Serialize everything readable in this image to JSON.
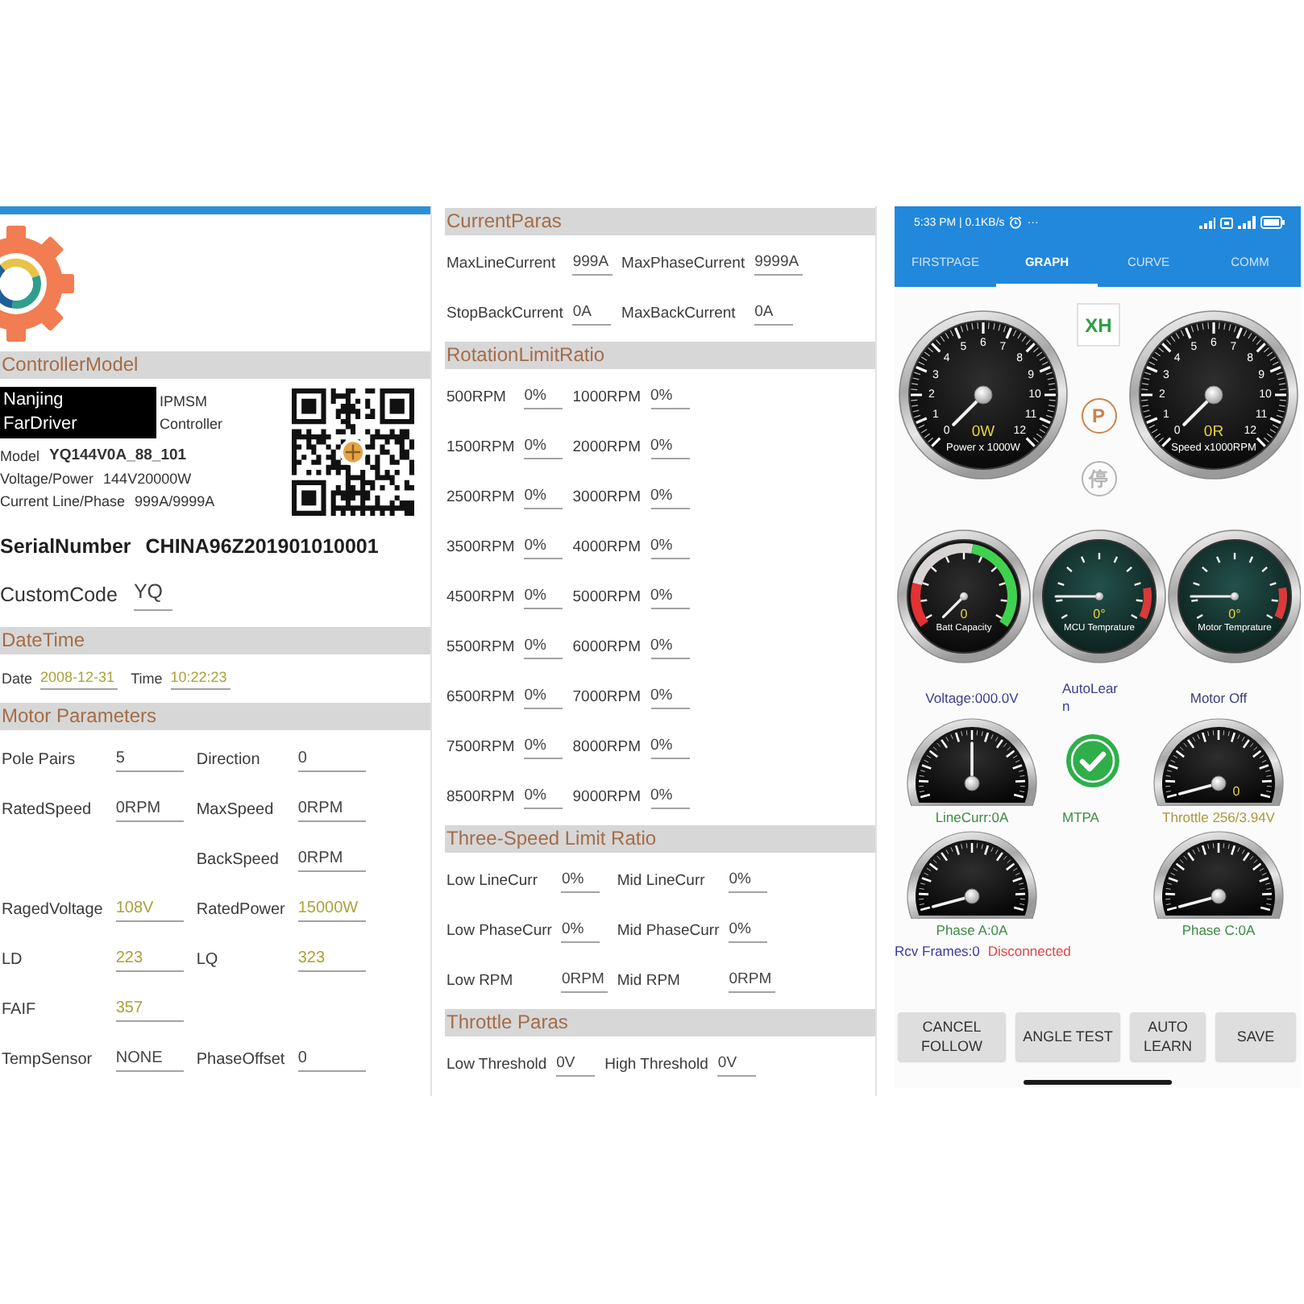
{
  "left_panel": {
    "controller_model": {
      "title": "ControllerModel",
      "maker": "Nanjing FarDriver",
      "type": "IPMSM Controller",
      "specs": [
        {
          "label": "Model",
          "value": "YQ144V0A_88_101"
        },
        {
          "label": "Voltage/Power",
          "value": "144V20000W"
        },
        {
          "label": "Current Line/Phase",
          "value": "999A/9999A"
        }
      ],
      "serial": {
        "label": "SerialNumber",
        "value": "CHINA96Z201901010001"
      },
      "custom_code": {
        "label": "CustomCode",
        "value": "YQ"
      }
    },
    "date_time": {
      "title": "DateTime",
      "fields": [
        {
          "label": "Date",
          "value": "2008-12-31",
          "color": "#aba33b"
        },
        {
          "label": "Time",
          "value": "10:22:23",
          "color": "#aba33b"
        }
      ]
    },
    "motor_parameters": {
      "title": "Motor Parameters",
      "rows": [
        {
          "left": {
            "label": "Pole Pairs",
            "value": "5",
            "color": "#444444"
          },
          "right": {
            "label": "Direction",
            "value": "0",
            "color": "#444444"
          }
        },
        {
          "left": {
            "label": "RatedSpeed",
            "value": "0RPM",
            "color": "#444444"
          },
          "right": {
            "label": "MaxSpeed",
            "value": "0RPM",
            "color": "#444444"
          }
        },
        {
          "right": {
            "label": "BackSpeed",
            "value": "0RPM",
            "color": "#444444"
          }
        },
        {
          "left": {
            "label": "RagedVoltage",
            "value": "108V",
            "color": "#aba33b"
          },
          "right": {
            "label": "RatedPower",
            "value": "15000W",
            "color": "#aba33b"
          }
        },
        {
          "left": {
            "label": "LD",
            "value": "223",
            "color": "#aba33b"
          },
          "right": {
            "label": "LQ",
            "value": "323",
            "color": "#aba33b"
          }
        },
        {
          "left": {
            "label": "FAIF",
            "value": "357",
            "color": "#aba33b"
          }
        },
        {
          "left": {
            "label": "TempSensor",
            "value": "NONE",
            "color": "#444444"
          },
          "right": {
            "label": "PhaseOffset",
            "value": "0",
            "color": "#444444"
          }
        }
      ]
    }
  },
  "middle_panel": {
    "sections": [
      {
        "title": "CurrentParas",
        "rows": [
          {
            "left": {
              "label": "MaxLineCurrent",
              "value": "999A"
            },
            "right": {
              "label": "MaxPhaseCurrent",
              "value": "9999A"
            }
          },
          {
            "left": {
              "label": "StopBackCurrent",
              "value": "0A"
            },
            "right": {
              "label": "MaxBackCurrent",
              "value": "0A"
            }
          }
        ]
      },
      {
        "title": "RotationLimitRatio",
        "rows": [
          {
            "left": {
              "label": "500RPM",
              "value": "0%"
            },
            "right": {
              "label": "1000RPM",
              "value": "0%"
            }
          },
          {
            "left": {
              "label": "1500RPM",
              "value": "0%"
            },
            "right": {
              "label": "2000RPM",
              "value": "0%"
            }
          },
          {
            "left": {
              "label": "2500RPM",
              "value": "0%"
            },
            "right": {
              "label": "3000RPM",
              "value": "0%"
            }
          },
          {
            "left": {
              "label": "3500RPM",
              "value": "0%"
            },
            "right": {
              "label": "4000RPM",
              "value": "0%"
            }
          },
          {
            "left": {
              "label": "4500RPM",
              "value": "0%"
            },
            "right": {
              "label": "5000RPM",
              "value": "0%"
            }
          },
          {
            "left": {
              "label": "5500RPM",
              "value": "0%"
            },
            "right": {
              "label": "6000RPM",
              "value": "0%"
            }
          },
          {
            "left": {
              "label": "6500RPM",
              "value": "0%"
            },
            "right": {
              "label": "7000RPM",
              "value": "0%"
            }
          },
          {
            "left": {
              "label": "7500RPM",
              "value": "0%"
            },
            "right": {
              "label": "8000RPM",
              "value": "0%"
            }
          },
          {
            "left": {
              "label": "8500RPM",
              "value": "0%"
            },
            "right": {
              "label": "9000RPM",
              "value": "0%"
            }
          }
        ]
      },
      {
        "title": "Three-Speed Limit Ratio",
        "rows": [
          {
            "left": {
              "label": "Low LineCurr",
              "value": "0%"
            },
            "right": {
              "label": "Mid LineCurr",
              "value": "0%"
            }
          },
          {
            "left": {
              "label": "Low PhaseCurr",
              "value": "0%"
            },
            "right": {
              "label": "Mid PhaseCurr",
              "value": "0%"
            }
          },
          {
            "left": {
              "label": "Low RPM",
              "value": "0RPM"
            },
            "right": {
              "label": "Mid RPM",
              "value": "0RPM"
            }
          }
        ]
      },
      {
        "title": "Throttle Paras",
        "rows": [
          {
            "left": {
              "label": "Low Threshold",
              "value": "0V"
            },
            "right": {
              "label": "High Threshold",
              "value": "0V"
            }
          }
        ]
      }
    ]
  },
  "phone": {
    "status_bar": {
      "info": "5:33 PM | 0.1KB/s",
      "more": "···"
    },
    "tabs": [
      {
        "label": "FIRSTPAGE",
        "selected": false
      },
      {
        "label": "GRAPH",
        "selected": true
      },
      {
        "label": "CURVE",
        "selected": false
      },
      {
        "label": "COMM",
        "selected": false
      }
    ],
    "main_gauges": [
      {
        "reading": "0W",
        "caption": "Power x 1000W",
        "ticks": [
          "0",
          "1",
          "2",
          "3",
          "4",
          "5",
          "6",
          "7",
          "8",
          "9",
          "10",
          "11",
          "12"
        ]
      },
      {
        "reading": "0R",
        "caption": "Speed x1000RPM",
        "ticks": [
          "0",
          "1",
          "2",
          "3",
          "4",
          "5",
          "6",
          "7",
          "8",
          "9",
          "10",
          "11",
          "12"
        ]
      }
    ],
    "indicators": [
      {
        "kind": "box",
        "text": "XH",
        "color": "#2e9e45"
      },
      {
        "kind": "circle",
        "text": "P",
        "color": "#c9824a"
      },
      {
        "kind": "circle",
        "text": "停",
        "color": "#b4b4b4"
      }
    ],
    "small_gauges": [
      {
        "kind": "battery",
        "reading": "0",
        "caption": "Batt Capacity"
      },
      {
        "kind": "temperature",
        "reading": "0°",
        "caption": "MCU Temprature"
      },
      {
        "kind": "temperature",
        "reading": "0°",
        "caption": "Motor Temprature"
      }
    ],
    "meter_grid": [
      {
        "left": {
          "kind": "label",
          "text": "Voltage:000.0V",
          "color": "#3d3d96"
        },
        "center": {
          "kind": "label",
          "text": "AutoLearn",
          "color": "#3d3d96"
        },
        "right": {
          "kind": "label",
          "text": "Motor Off",
          "color": "#3d3d7a"
        }
      },
      {
        "left": {
          "kind": "bipolar_gauge"
        },
        "center": {
          "kind": "check",
          "checked": true
        },
        "right": {
          "kind": "gauge",
          "reading": "0"
        }
      },
      {
        "left": {
          "kind": "label",
          "text": "LineCurr:0A",
          "color": "#3e8a45"
        },
        "center": {
          "kind": "label",
          "text": "MTPA",
          "color": "#3e8a45"
        },
        "right": {
          "kind": "label",
          "text": "Throttle 256/3.94V",
          "color": "#a69a3c"
        }
      },
      {
        "left": {
          "kind": "gauge"
        },
        "right": {
          "kind": "gauge"
        }
      },
      {
        "left": {
          "kind": "label",
          "text": "Phase A:0A",
          "color": "#3e8a45"
        },
        "right": {
          "kind": "label",
          "text": "Phase C:0A",
          "color": "#3e8a45"
        }
      }
    ],
    "connection": {
      "frames": "Rcv Frames:0",
      "status": "Disconnected"
    },
    "buttons": [
      "CANCEL FOLLOW",
      "ANGLE TEST",
      "AUTO LEARN",
      "SAVE"
    ]
  }
}
